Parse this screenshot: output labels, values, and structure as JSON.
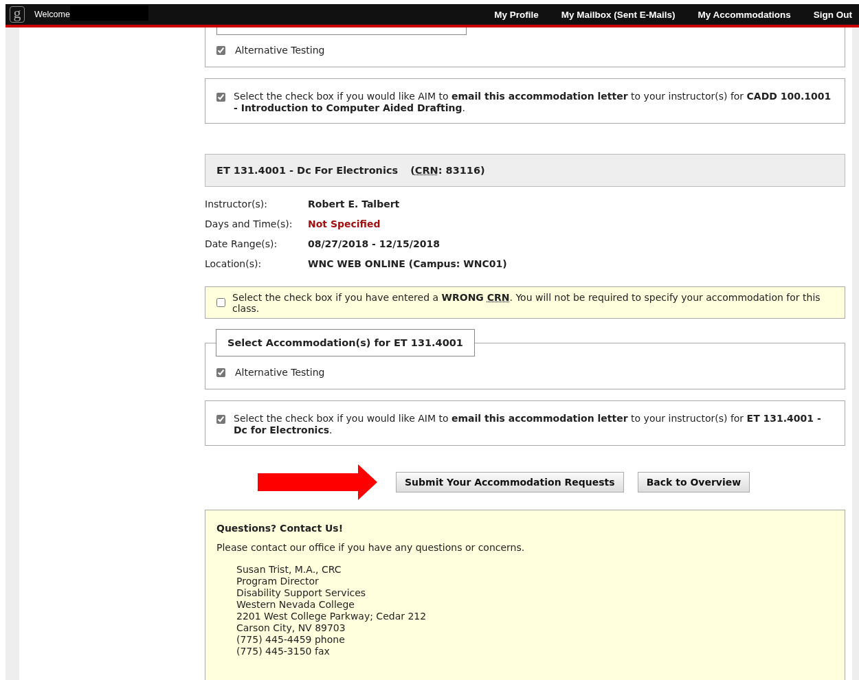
{
  "header": {
    "logo": "g",
    "welcome": "Welcome",
    "nav": [
      {
        "label": "My Profile"
      },
      {
        "label": "My Mailbox (Sent E-Mails)"
      },
      {
        "label": "My Accommodations"
      },
      {
        "label": "Sign Out"
      }
    ]
  },
  "previous_course": {
    "accommodations": [
      {
        "label": "Alternative Testing",
        "checked": true
      }
    ],
    "email_option": {
      "checked": true,
      "text": "Select the check box if you would like AIM to **email this accommodation letter** to your instructor(s) for **CADD 100.1001 - Introduction to Computer Aided Drafting**."
    }
  },
  "course": {
    "title": "ET 131.4001 - Dc For Electronics",
    "crn": [
      {
        "kind": "text",
        "text": "("
      },
      {
        "kind": "abbr",
        "text": "CRN"
      },
      {
        "kind": "text",
        "text": ": 83116)"
      }
    ],
    "details": [
      {
        "label": "Instructor(s):",
        "value": "Robert E. Talbert",
        "kind": "normal"
      },
      {
        "label": "Days and Time(s):",
        "value": "Not Specified",
        "kind": "alert"
      },
      {
        "label": "Date Range(s):",
        "value": "08/27/2018 - 12/15/2018",
        "kind": "normal"
      },
      {
        "label": "Location(s):",
        "value": "WNC WEB ONLINE (Campus: WNC01)",
        "kind": "normal"
      }
    ],
    "wrong_crn": {
      "checked": false,
      "segments": [
        {
          "kind": "text",
          "text": "Select the check box if you have entered a "
        },
        {
          "kind": "bold",
          "text": "WRONG "
        },
        {
          "kind": "abbr",
          "text": "CRN"
        },
        {
          "kind": "text",
          "text": ". You will not be required to specify your accommodation for this class."
        }
      ]
    },
    "accommodation_legend": "Select Accommodation(s) for ET 131.4001",
    "accommodations": [
      {
        "label": "Alternative Testing",
        "checked": true
      }
    ],
    "email_option": {
      "checked": true,
      "text": "Select the check box if you would like AIM to **email this accommodation letter** to your instructor(s) for **ET 131.4001 - Dc for Electronics**."
    }
  },
  "buttons": [
    {
      "label": "Submit Your Accommodation Requests"
    },
    {
      "label": "Back to Overview"
    }
  ],
  "contact": {
    "title": "Questions? Contact Us!",
    "intro": "Please contact our office if you have any questions or concerns.",
    "lines": [
      "Susan Trist, M.A., CRC",
      "Program Director",
      "Disability Support Services",
      "Western Nevada College",
      "2201 West College Parkway; Cedar 212",
      "Carson City, NV 89703",
      "(775) 445-4459 phone",
      "(775) 445-3150 fax"
    ]
  }
}
